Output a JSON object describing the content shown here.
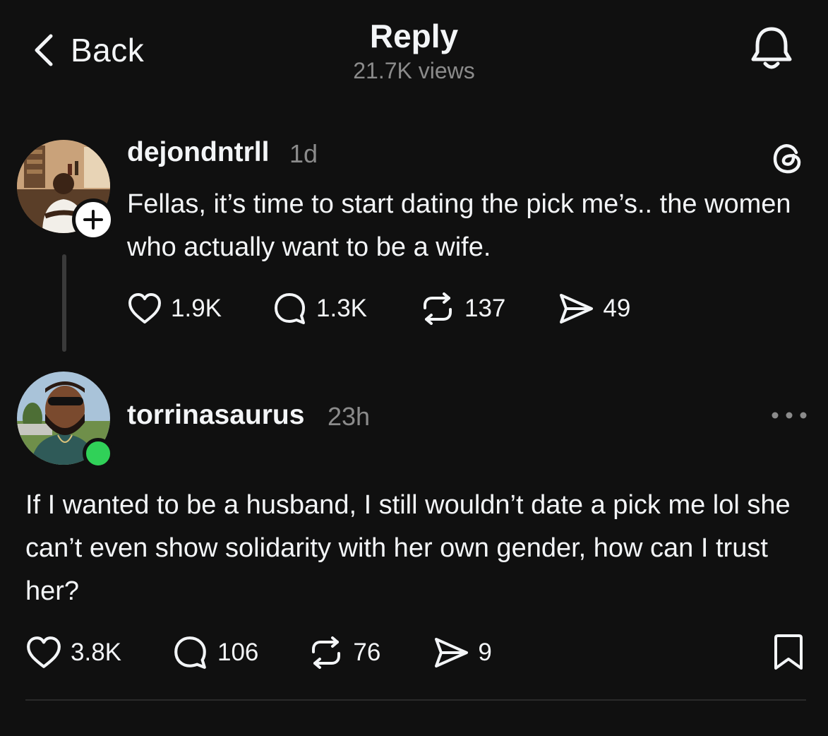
{
  "header": {
    "back_label": "Back",
    "title": "Reply",
    "views": "21.7K views"
  },
  "parent_post": {
    "username": "dejondntrll",
    "time": "1d",
    "text": "Fellas, it’s time to start dating the pick me’s.. the women who actually want to be a wife.",
    "likes": "1.9K",
    "replies": "1.3K",
    "reposts": "137",
    "shares": "49"
  },
  "reply_post": {
    "username": "torrinasaurus",
    "time": "23h",
    "text": "If I wanted to be a husband, I still wouldn’t date a pick me lol she can’t even show solidarity with her own gender, how can I trust her?",
    "likes": "3.8K",
    "replies": "106",
    "reposts": "76",
    "shares": "9"
  },
  "colors": {
    "background": "#101010",
    "text": "#f3f5f7",
    "muted": "#8b8b8b",
    "online": "#30d158"
  },
  "icons": [
    "chevron-left-icon",
    "bell-icon",
    "threads-logo-icon",
    "plus-icon",
    "heart-icon",
    "comment-icon",
    "repost-icon",
    "send-icon",
    "more-icon",
    "bookmark-icon"
  ]
}
